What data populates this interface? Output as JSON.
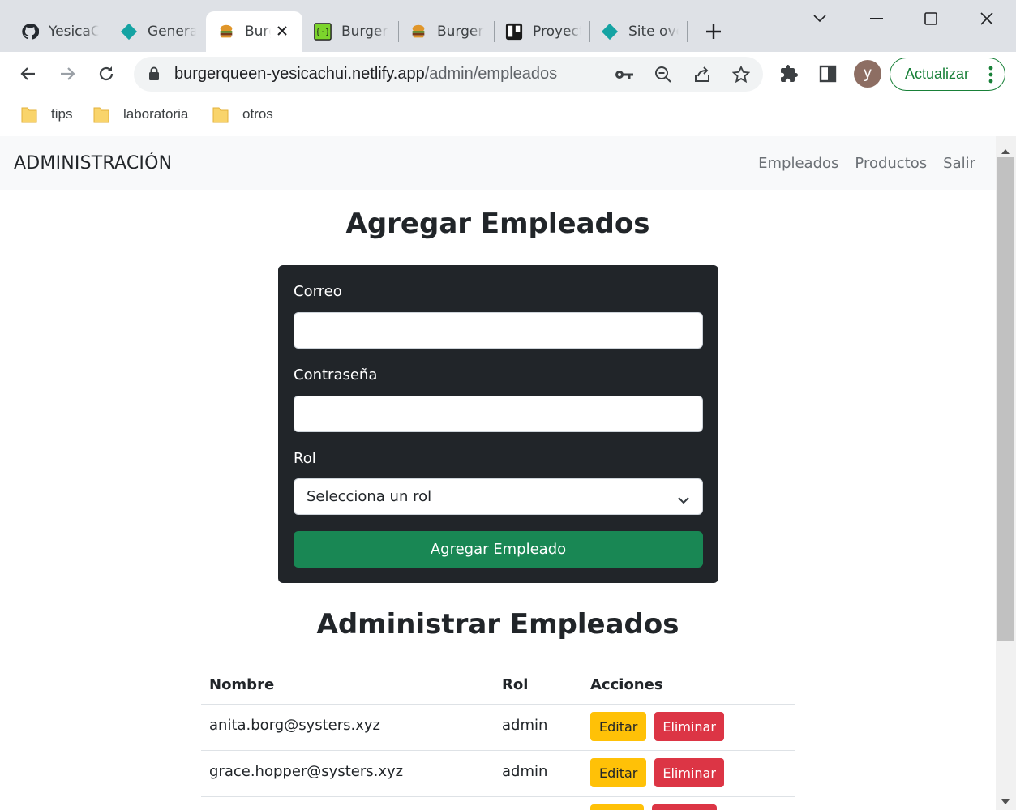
{
  "browser": {
    "tabs": [
      {
        "label": "YesicaC",
        "icon": "github-icon"
      },
      {
        "label": "General",
        "icon": "netlify-icon"
      },
      {
        "label": "Burger",
        "icon": "burger-icon",
        "active": true
      },
      {
        "label": "BurgerC",
        "icon": "code-icon"
      },
      {
        "label": "Burger",
        "icon": "burger-icon"
      },
      {
        "label": "Proyect",
        "icon": "trello-icon"
      },
      {
        "label": "Site ove",
        "icon": "netlify-icon"
      }
    ],
    "url_host": "burgerqueen-yesicachui.netlify.app",
    "url_path": "/admin/empleados",
    "avatar_initial": "y",
    "update_label": "Actualizar",
    "bookmarks": [
      "tips",
      "laboratoria",
      "otros"
    ]
  },
  "nav": {
    "brand": "ADMINISTRACIÓN",
    "links": [
      "Empleados",
      "Productos",
      "Salir"
    ]
  },
  "form": {
    "title": "Agregar Empleados",
    "email_label": "Correo",
    "email_value": "",
    "password_label": "Contraseña",
    "password_value": "",
    "role_label": "Rol",
    "role_selected": "Selecciona un rol",
    "submit_label": "Agregar Empleado"
  },
  "table": {
    "title": "Administrar Empleados",
    "headers": [
      "Nombre",
      "Rol",
      "Acciones"
    ],
    "rows": [
      {
        "name": "anita.borg@systers.xyz",
        "role": "admin"
      },
      {
        "name": "grace.hopper@systers.xyz",
        "role": "admin"
      }
    ],
    "edit_label": "Editar",
    "delete_label": "Eliminar"
  },
  "colors": {
    "card_bg": "#212529",
    "primary_green": "#198754",
    "edit_yellow": "#ffc107",
    "delete_red": "#dc3545",
    "nav_bg": "#f8f9fa"
  }
}
